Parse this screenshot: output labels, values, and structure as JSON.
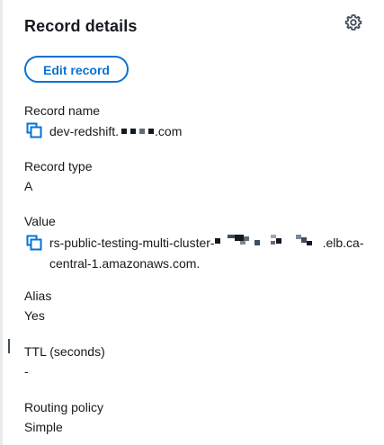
{
  "panel": {
    "title": "Record details",
    "settings_icon": "gear-icon",
    "edit_button": "Edit record"
  },
  "record_name": {
    "label": "Record name",
    "value_prefix": "dev-redshift.",
    "value_suffix": ".com"
  },
  "record_type": {
    "label": "Record type",
    "value": "A"
  },
  "value": {
    "label": "Value",
    "value_prefix": "rs-public-testing-multi-cluster-",
    "value_suffix": ".elb.ca-central-1.amazonaws.com."
  },
  "alias": {
    "label": "Alias",
    "value": "Yes"
  },
  "ttl": {
    "label": "TTL (seconds)",
    "value": "-"
  },
  "routing_policy": {
    "label": "Routing policy",
    "value": "Simple"
  },
  "colors": {
    "link": "#0972d3",
    "text": "#16191f",
    "border": "#e9ebed"
  }
}
